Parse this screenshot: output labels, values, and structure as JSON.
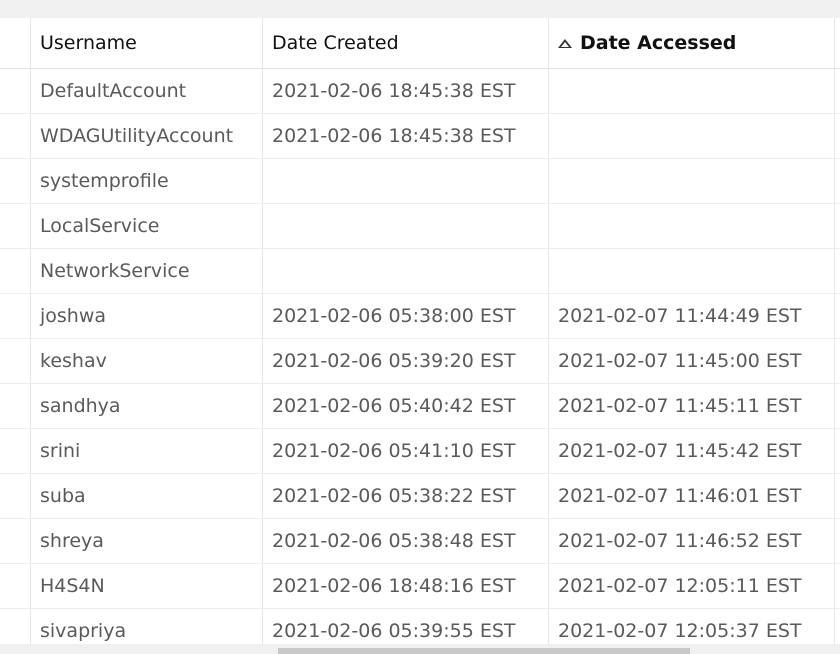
{
  "table": {
    "columns": {
      "username": "Username",
      "date_created": "Date Created",
      "date_accessed": "Date Accessed"
    },
    "sort": {
      "column": "date_accessed",
      "direction": "ascending",
      "icon": "sort-ascending-icon"
    },
    "rows": [
      {
        "username": "DefaultAccount",
        "date_created": "2021-02-06 18:45:38 EST",
        "date_accessed": ""
      },
      {
        "username": "WDAGUtilityAccount",
        "date_created": "2021-02-06 18:45:38 EST",
        "date_accessed": ""
      },
      {
        "username": "systemprofile",
        "date_created": "",
        "date_accessed": ""
      },
      {
        "username": "LocalService",
        "date_created": "",
        "date_accessed": ""
      },
      {
        "username": "NetworkService",
        "date_created": "",
        "date_accessed": ""
      },
      {
        "username": "joshwa",
        "date_created": "2021-02-06 05:38:00 EST",
        "date_accessed": "2021-02-07 11:44:49 EST"
      },
      {
        "username": "keshav",
        "date_created": "2021-02-06 05:39:20 EST",
        "date_accessed": "2021-02-07 11:45:00 EST"
      },
      {
        "username": "sandhya",
        "date_created": "2021-02-06 05:40:42 EST",
        "date_accessed": "2021-02-07 11:45:11 EST"
      },
      {
        "username": "srini",
        "date_created": "2021-02-06 05:41:10 EST",
        "date_accessed": "2021-02-07 11:45:42 EST"
      },
      {
        "username": "suba",
        "date_created": "2021-02-06 05:38:22 EST",
        "date_accessed": "2021-02-07 11:46:01 EST"
      },
      {
        "username": "shreya",
        "date_created": "2021-02-06 05:38:48 EST",
        "date_accessed": "2021-02-07 11:46:52 EST"
      },
      {
        "username": "H4S4N",
        "date_created": "2021-02-06 18:48:16 EST",
        "date_accessed": "2021-02-07 12:05:11 EST"
      },
      {
        "username": "sivapriya",
        "date_created": "2021-02-06 05:39:55 EST",
        "date_accessed": "2021-02-07 12:05:37 EST"
      }
    ]
  },
  "colors": {
    "header_text": "#111111",
    "cell_text": "#5a5a5a",
    "grid_line": "#e6e6e6",
    "background": "#ffffff"
  }
}
